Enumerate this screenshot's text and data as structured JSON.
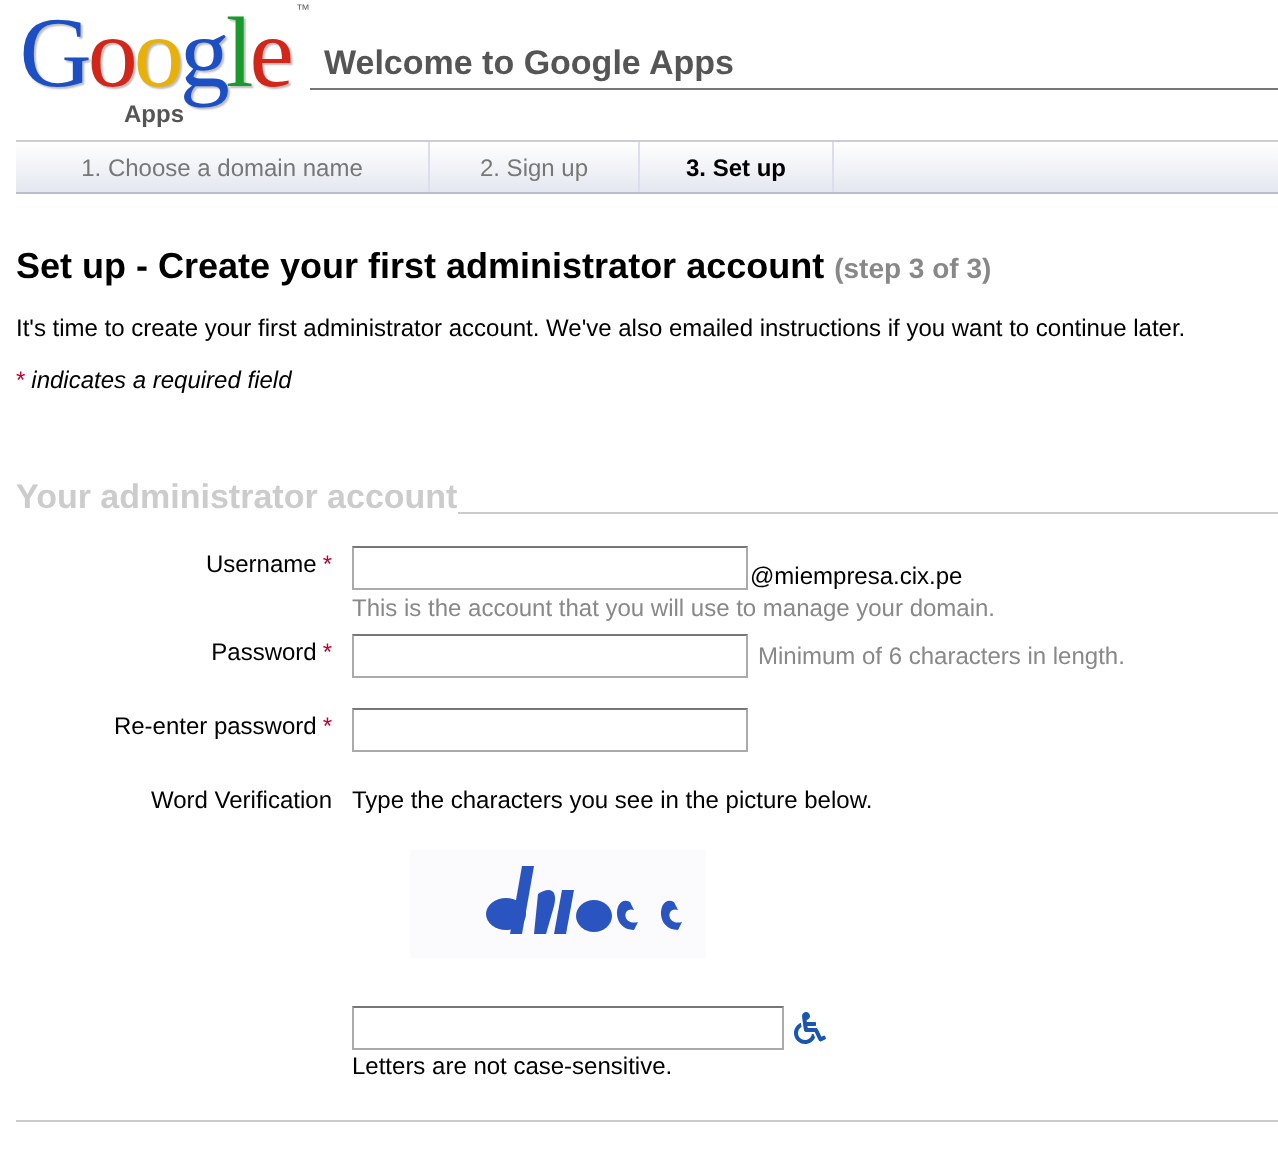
{
  "logo": {
    "word": "Google",
    "trademark": "™",
    "product": "Apps"
  },
  "header": {
    "title": "Welcome to Google Apps"
  },
  "tabs": [
    {
      "label": "1. Choose a domain name",
      "selected": false
    },
    {
      "label": "2. Sign up",
      "selected": false
    },
    {
      "label": "3. Set up",
      "selected": true
    }
  ],
  "heading": {
    "title": "Set up - Create your first administrator account",
    "step": "(step 3 of 3)"
  },
  "intro": "It's time to create your first administrator account. We've also emailed instructions if you want to continue later.",
  "legend": {
    "mark": "*",
    "text": "indicates a required field"
  },
  "section": {
    "title": "Your administrator account"
  },
  "fields": [
    {
      "kind": "text",
      "label": "Username",
      "required": true,
      "mark": "*",
      "suffix": "@miempresa.cix.pe",
      "hint": "This is the account that you will use to manage your domain."
    },
    {
      "kind": "password",
      "label": "Password",
      "required": true,
      "mark": "*",
      "side_hint": "Minimum of 6 characters in length."
    },
    {
      "kind": "password",
      "label": "Re-enter password",
      "required": true,
      "mark": "*"
    },
    {
      "kind": "captcha",
      "label": "Word Verification",
      "required": false,
      "instructions": "Type the characters you see in the picture below.",
      "note": "Letters are not case-sensitive."
    }
  ]
}
